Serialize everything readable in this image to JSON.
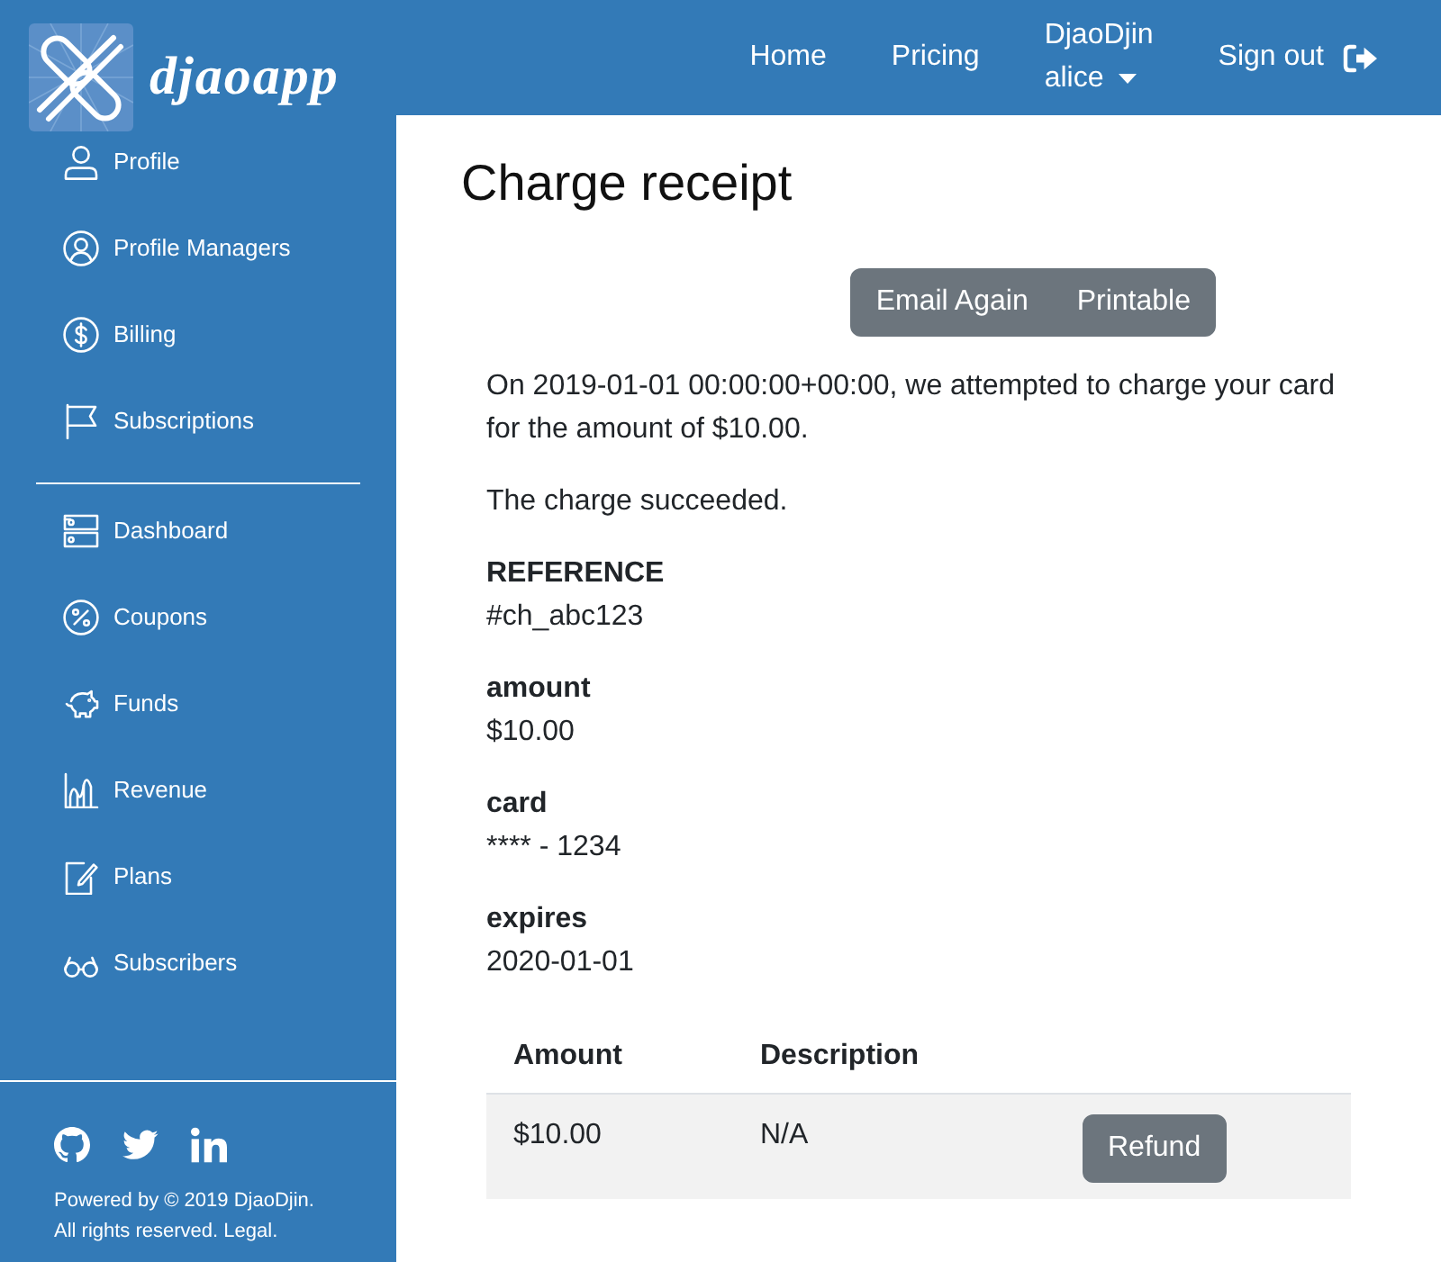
{
  "navbar": {
    "brand": "djaoapp",
    "links": [
      {
        "label": "Home"
      },
      {
        "label": "Pricing"
      }
    ],
    "account": {
      "organization": "DjaoDjin",
      "user": "alice"
    },
    "sign_out": "Sign out"
  },
  "sidebar": {
    "groups": [
      {
        "items": [
          {
            "label": "Profile"
          },
          {
            "label": "Profile Managers"
          },
          {
            "label": "Billing"
          },
          {
            "label": "Subscriptions"
          }
        ]
      },
      {
        "items": [
          {
            "label": "Dashboard"
          },
          {
            "label": "Coupons"
          },
          {
            "label": "Funds"
          },
          {
            "label": "Revenue"
          },
          {
            "label": "Plans"
          },
          {
            "label": "Subscribers"
          }
        ]
      }
    ],
    "footer": {
      "copyright": "Powered by © 2019 DjaoDjin.",
      "rights": "All rights reserved.",
      "legal_link": "Legal."
    }
  },
  "page": {
    "title": "Charge receipt",
    "actions": [
      "Email Again",
      "Printable"
    ],
    "message": "On 2019-01-01 00:00:00+00:00, we attempted to charge your card for the amount of $10.00.",
    "status": "The charge succeeded.",
    "details": [
      {
        "label": "REFERENCE",
        "value": "#ch_abc123"
      },
      {
        "label": "amount",
        "value": "$10.00"
      },
      {
        "label": "card",
        "value": "**** - 1234"
      },
      {
        "label": "expires",
        "value": "2020-01-01"
      }
    ],
    "table": {
      "columns": [
        "Amount",
        "Description"
      ],
      "rows": [
        {
          "cells": [
            "$10.00",
            "N/A"
          ],
          "action": "Refund"
        }
      ]
    }
  }
}
